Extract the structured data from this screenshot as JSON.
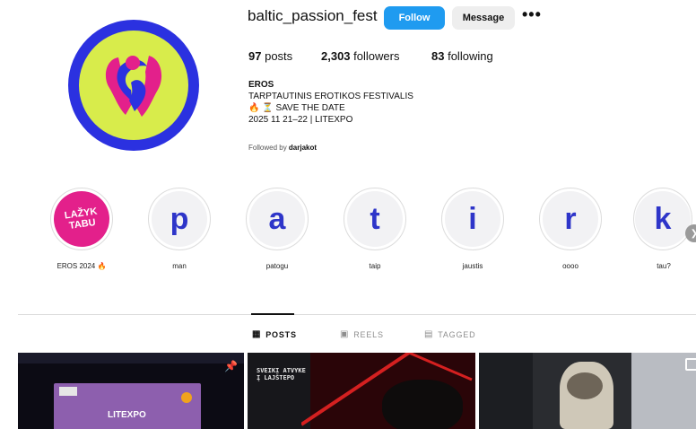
{
  "profile": {
    "username": "baltic_passion_fest",
    "follow_label": "Follow",
    "message_label": "Message",
    "more_label": "•••",
    "posts_count": "97",
    "posts_label": "posts",
    "followers_count": "2,303",
    "followers_label": "followers",
    "following_count": "83",
    "following_label": "following"
  },
  "bio": {
    "name": "EROS",
    "line1": "TARPTAUTINIS EROTIKOS FESTIVALIS",
    "line2": "🔥 ⏳ SAVE THE DATE",
    "line3": "2025 11 21–22 | LITEXPO",
    "followed_prefix": "Followed by",
    "followed_user": "darjakot"
  },
  "highlights": [
    {
      "letter": "LAŽYK TABU",
      "label": "EROS 2024 🔥"
    },
    {
      "letter": "p",
      "label": "man"
    },
    {
      "letter": "a",
      "label": "patogu"
    },
    {
      "letter": "t",
      "label": "taip"
    },
    {
      "letter": "i",
      "label": "jaustis"
    },
    {
      "letter": "r",
      "label": "oooo"
    },
    {
      "letter": "k",
      "label": "tau?"
    }
  ],
  "tabs": [
    {
      "icon": "▦",
      "label": "POSTS"
    },
    {
      "icon": "▣",
      "label": "REELS"
    },
    {
      "icon": "▤",
      "label": "TAGGED"
    }
  ],
  "posts": [
    {
      "text": "LITEXPO"
    },
    {
      "text": "SVEIKI ATVYKE Į LAJŠTEPO"
    },
    {
      "text": ""
    }
  ],
  "colors": {
    "follow_button": "#1f9bf0",
    "avatar_ring": "#2b31e0",
    "avatar_fill": "#d8ec4b",
    "highlight_letters": "#2e35c9",
    "first_highlight": "#e3208b"
  }
}
